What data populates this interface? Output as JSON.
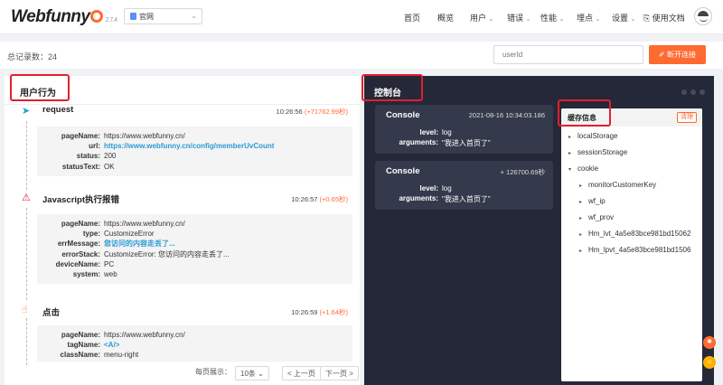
{
  "header": {
    "logo": "Webfunny",
    "version": "2.7.4",
    "project": "官网",
    "nav": [
      "首页",
      "概览",
      "用户",
      "错误",
      "性能",
      "埋点",
      "设置",
      "使用文档"
    ],
    "accent": "#ff6a30"
  },
  "toolbar": {
    "total_label": "总记录数：",
    "total_value": "24",
    "userid_placeholder": "userId",
    "disconnect_label": "断开连接"
  },
  "behavior": {
    "title": "用户行为",
    "events": [
      {
        "icon": "send-icon",
        "title": "request",
        "time": "10:26:56",
        "delta": "(+71762.99秒)",
        "fields": [
          {
            "k": "pageName:",
            "v": "https://www.webfunny.cn/"
          },
          {
            "k": "url:",
            "v": "https://www.webfunny.cn/config/memberUvCount"
          },
          {
            "k": "status:",
            "v": "200"
          },
          {
            "k": "statusText:",
            "v": "OK"
          }
        ]
      },
      {
        "icon": "warning-icon",
        "title": "Javascript执行报错",
        "time": "10:26:57",
        "delta": "(+0.65秒)",
        "fields": [
          {
            "k": "pageName:",
            "v": "https://www.webfunny.cn/"
          },
          {
            "k": "type:",
            "v": "CustomizeError"
          },
          {
            "k": "errMessage:",
            "v": "您访问的内容走丢了..."
          },
          {
            "k": "errorStack:",
            "v": "CustomizeError: 您访问的内容走丢了..."
          },
          {
            "k": "deviceName:",
            "v": "PC"
          },
          {
            "k": "system:",
            "v": "web"
          }
        ]
      },
      {
        "icon": "hand-pointer-icon",
        "title": "点击",
        "time": "10:26:59",
        "delta": "(+1.64秒)",
        "fields": [
          {
            "k": "pageName:",
            "v": "https://www.webfunny.cn/"
          },
          {
            "k": "tagName:",
            "v": "<A/>"
          },
          {
            "k": "className:",
            "v": "menu-right"
          }
        ]
      }
    ],
    "pagination": {
      "per_page_label": "每页展示：",
      "per_page_value": "10条",
      "prev": "< 上一页",
      "next": "下一页 >"
    }
  },
  "console_panel": {
    "title": "控制台",
    "entries": [
      {
        "title": "Console",
        "time": "2021-08-16 10:34:03.186",
        "level": "log",
        "arguments": "\"我进入首页了\""
      },
      {
        "title": "Console",
        "time": "+ 126700.69秒",
        "level": "log",
        "arguments": "\"我进入首页了\""
      }
    ],
    "level_key": "level:",
    "arguments_key": "arguments:",
    "cache": {
      "title": "缓存信息",
      "clear_label": "清理",
      "items": [
        {
          "label": "localStorage",
          "expanded": false,
          "depth": 0
        },
        {
          "label": "sessionStorage",
          "expanded": false,
          "depth": 0
        },
        {
          "label": "cookie",
          "expanded": true,
          "depth": 0
        },
        {
          "label": "monitorCustomerKey",
          "expanded": false,
          "depth": 1
        },
        {
          "label": "wf_ip",
          "expanded": false,
          "depth": 1
        },
        {
          "label": "wf_prov",
          "expanded": false,
          "depth": 1
        },
        {
          "label": "Hm_lvt_4a5e83bce981bd15062",
          "expanded": false,
          "depth": 1
        },
        {
          "label": "Hm_lpvt_4a5e83bce981bd1506",
          "expanded": false,
          "depth": 1
        }
      ]
    }
  }
}
